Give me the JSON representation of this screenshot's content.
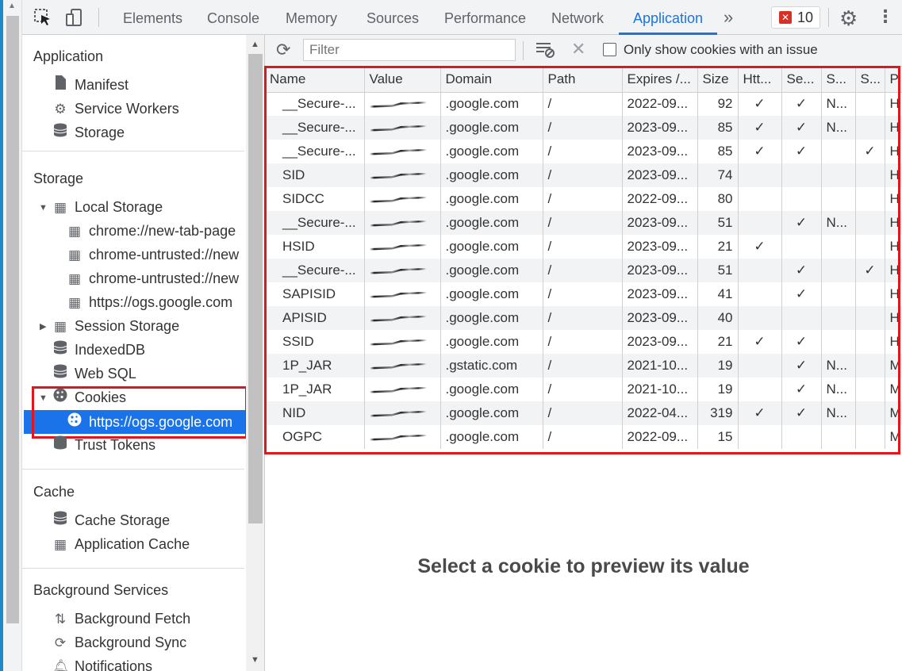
{
  "tabs": [
    {
      "label": "Elements",
      "active": false
    },
    {
      "label": "Console",
      "active": false
    },
    {
      "label": "Memory",
      "active": false
    },
    {
      "label": "Sources",
      "active": false
    },
    {
      "label": "Performance",
      "active": false
    },
    {
      "label": "Network",
      "active": false
    },
    {
      "label": "Application",
      "active": true
    }
  ],
  "topbar": {
    "more": "»",
    "error_count": "10",
    "settings_icon": "gear-icon",
    "menu_icon": "kebab-icon"
  },
  "sidebar": {
    "application_title": "Application",
    "application_items": [
      {
        "label": "Manifest",
        "icon": "document-icon"
      },
      {
        "label": "Service Workers",
        "icon": "gear-icon"
      },
      {
        "label": "Storage",
        "icon": "database-icon"
      }
    ],
    "storage_title": "Storage",
    "local_storage": "Local Storage",
    "local_storage_children": [
      "chrome://new-tab-page",
      "chrome-untrusted://new",
      "chrome-untrusted://new",
      "https://ogs.google.com"
    ],
    "session_storage": "Session Storage",
    "indexeddb": "IndexedDB",
    "websql": "Web SQL",
    "cookies": "Cookies",
    "cookies_child": "https://ogs.google.com",
    "trust_tokens": "Trust Tokens",
    "cache_title": "Cache",
    "cache_items": [
      {
        "label": "Cache Storage",
        "icon": "database-icon"
      },
      {
        "label": "Application Cache",
        "icon": "grid-icon"
      }
    ],
    "bg_title": "Background Services",
    "bg_items": [
      {
        "label": "Background Fetch",
        "icon": "updown-arrows-icon"
      },
      {
        "label": "Background Sync",
        "icon": "sync-icon"
      },
      {
        "label": "Notifications",
        "icon": "bell-icon"
      }
    ]
  },
  "toolbar": {
    "filter_placeholder": "Filter",
    "only_issues_label": "Only show cookies with an issue",
    "only_issues_checked": false
  },
  "table": {
    "headers": [
      "Name",
      "Value",
      "Domain",
      "Path",
      "Expires /...",
      "Size",
      "Htt...",
      "Se...",
      "S...",
      "S...",
      "P"
    ],
    "rows": [
      {
        "name": "__Secure-...",
        "domain": ".google.com",
        "path": "/",
        "expires": "2022-09...",
        "size": "92",
        "http": "✓",
        "secure": "✓",
        "samesite": "N...",
        "sameparty": "",
        "p": "H"
      },
      {
        "name": "__Secure-...",
        "domain": ".google.com",
        "path": "/",
        "expires": "2023-09...",
        "size": "85",
        "http": "✓",
        "secure": "✓",
        "samesite": "N...",
        "sameparty": "",
        "p": "H"
      },
      {
        "name": "__Secure-...",
        "domain": ".google.com",
        "path": "/",
        "expires": "2023-09...",
        "size": "85",
        "http": "✓",
        "secure": "✓",
        "samesite": "",
        "sameparty": "✓",
        "p": "H"
      },
      {
        "name": "SID",
        "domain": ".google.com",
        "path": "/",
        "expires": "2023-09...",
        "size": "74",
        "http": "",
        "secure": "",
        "samesite": "",
        "sameparty": "",
        "p": "H"
      },
      {
        "name": "SIDCC",
        "domain": ".google.com",
        "path": "/",
        "expires": "2022-09...",
        "size": "80",
        "http": "",
        "secure": "",
        "samesite": "",
        "sameparty": "",
        "p": "H"
      },
      {
        "name": "__Secure-...",
        "domain": ".google.com",
        "path": "/",
        "expires": "2023-09...",
        "size": "51",
        "http": "",
        "secure": "✓",
        "samesite": "N...",
        "sameparty": "",
        "p": "H"
      },
      {
        "name": "HSID",
        "domain": ".google.com",
        "path": "/",
        "expires": "2023-09...",
        "size": "21",
        "http": "✓",
        "secure": "",
        "samesite": "",
        "sameparty": "",
        "p": "H"
      },
      {
        "name": "__Secure-...",
        "domain": ".google.com",
        "path": "/",
        "expires": "2023-09...",
        "size": "51",
        "http": "",
        "secure": "✓",
        "samesite": "",
        "sameparty": "✓",
        "p": "H"
      },
      {
        "name": "SAPISID",
        "domain": ".google.com",
        "path": "/",
        "expires": "2023-09...",
        "size": "41",
        "http": "",
        "secure": "✓",
        "samesite": "",
        "sameparty": "",
        "p": "H"
      },
      {
        "name": "APISID",
        "domain": ".google.com",
        "path": "/",
        "expires": "2023-09...",
        "size": "40",
        "http": "",
        "secure": "",
        "samesite": "",
        "sameparty": "",
        "p": "H"
      },
      {
        "name": "SSID",
        "domain": ".google.com",
        "path": "/",
        "expires": "2023-09...",
        "size": "21",
        "http": "✓",
        "secure": "✓",
        "samesite": "",
        "sameparty": "",
        "p": "H"
      },
      {
        "name": "1P_JAR",
        "domain": ".gstatic.com",
        "path": "/",
        "expires": "2021-10...",
        "size": "19",
        "http": "",
        "secure": "✓",
        "samesite": "N...",
        "sameparty": "",
        "p": "M"
      },
      {
        "name": "1P_JAR",
        "domain": ".google.com",
        "path": "/",
        "expires": "2021-10...",
        "size": "19",
        "http": "",
        "secure": "✓",
        "samesite": "N...",
        "sameparty": "",
        "p": "M"
      },
      {
        "name": "NID",
        "domain": ".google.com",
        "path": "/",
        "expires": "2022-04...",
        "size": "319",
        "http": "✓",
        "secure": "✓",
        "samesite": "N...",
        "sameparty": "",
        "p": "M"
      },
      {
        "name": "OGPC",
        "domain": ".google.com",
        "path": "/",
        "expires": "2022-09...",
        "size": "15",
        "http": "",
        "secure": "",
        "samesite": "",
        "sameparty": "",
        "p": "M"
      }
    ]
  },
  "preview_message": "Select a cookie to preview its value",
  "colors": {
    "accent": "#1a73e8",
    "highlight_box": "#e0161d",
    "error": "#d93025"
  }
}
